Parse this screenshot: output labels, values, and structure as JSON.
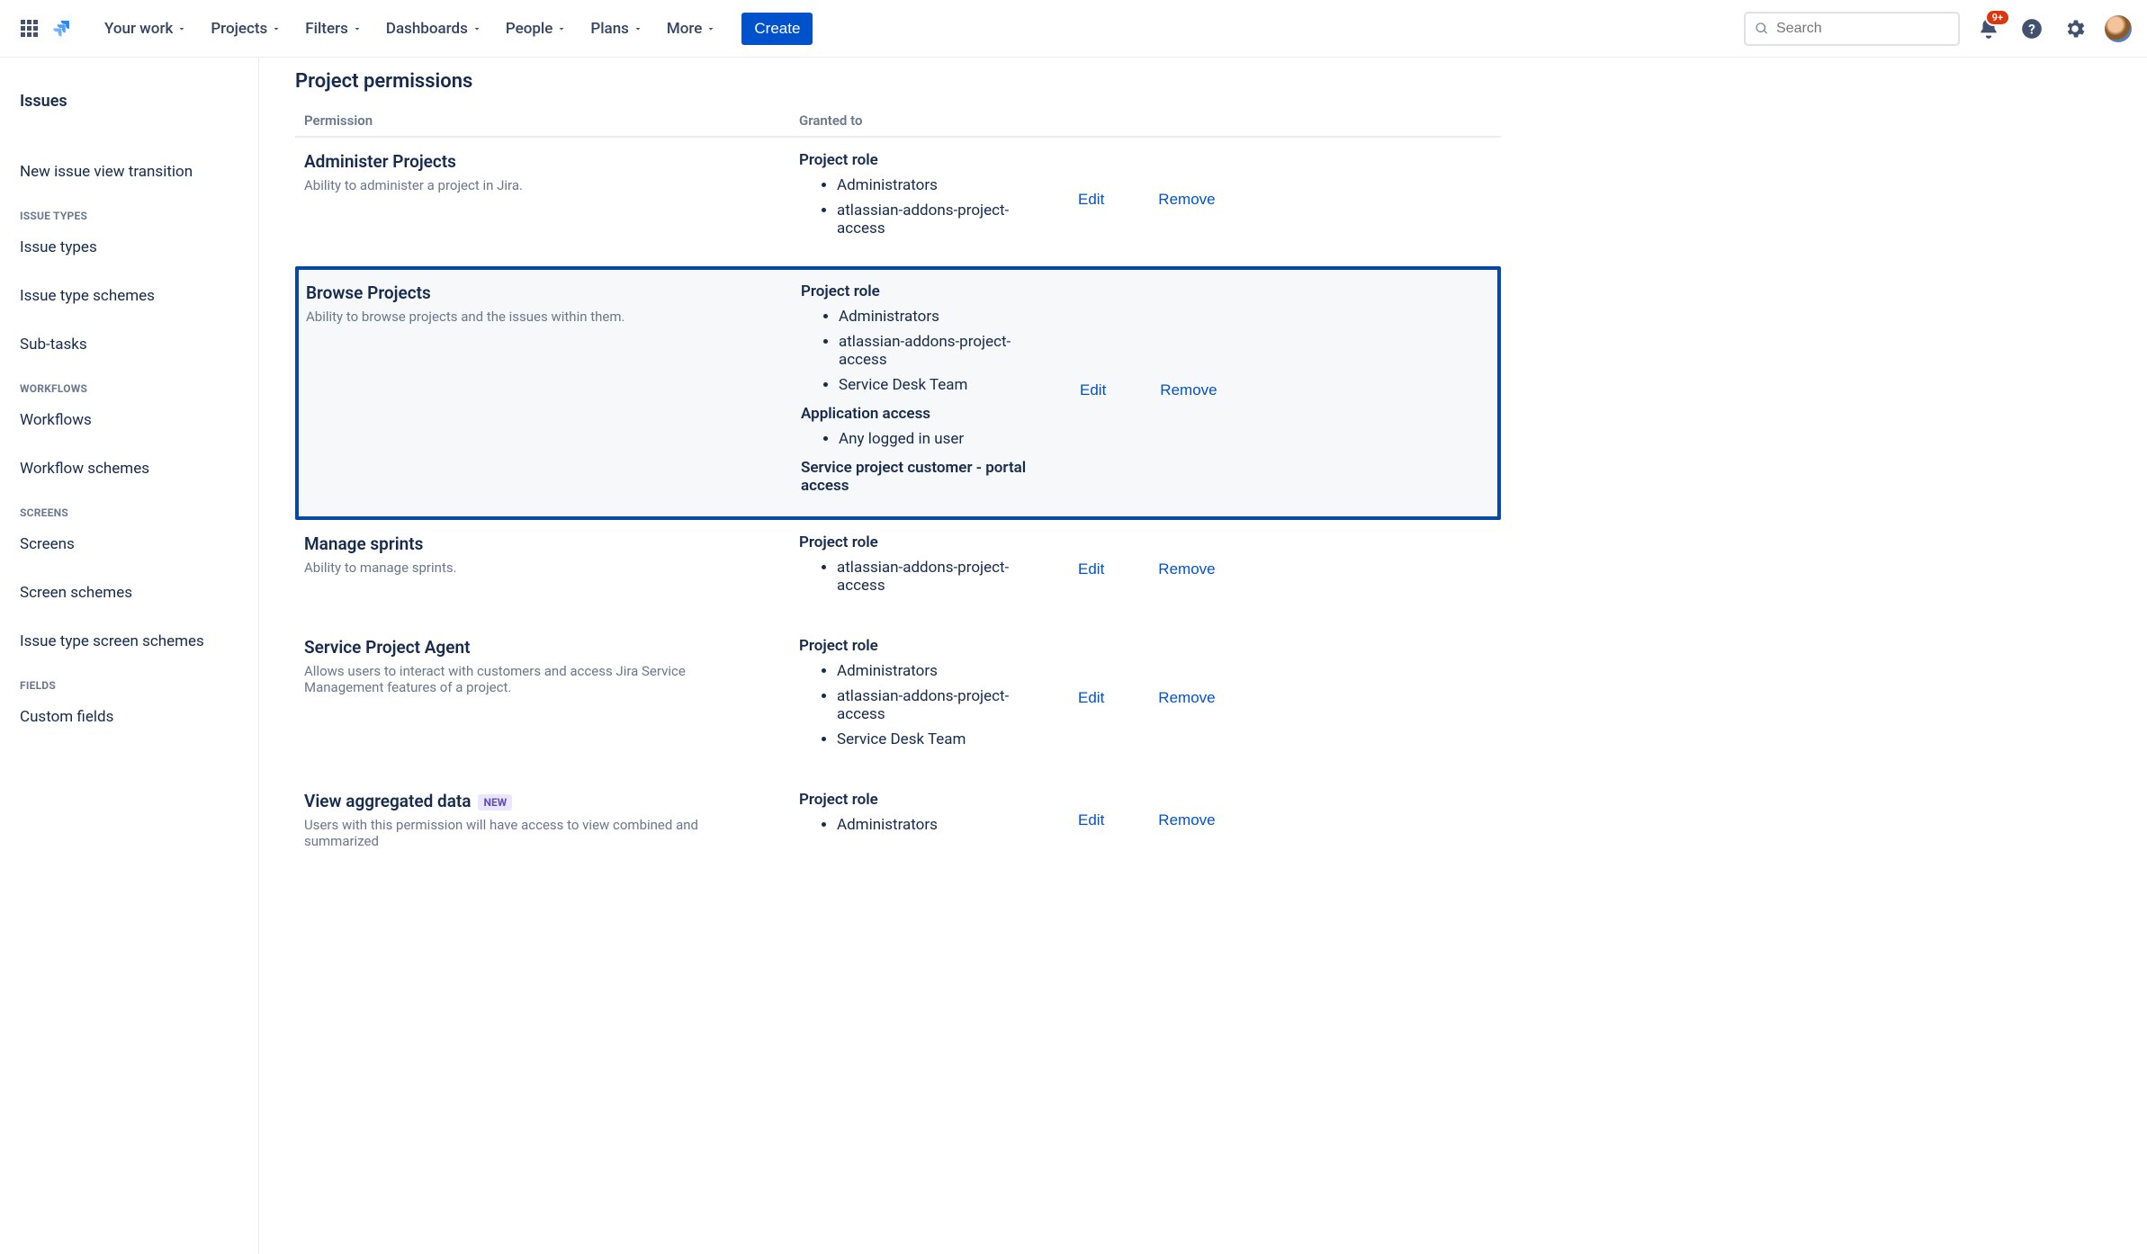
{
  "nav": {
    "items": [
      "Your work",
      "Projects",
      "Filters",
      "Dashboards",
      "People",
      "Plans",
      "More"
    ],
    "create": "Create",
    "search_placeholder": "Search",
    "notification_badge": "9+"
  },
  "sidebar": {
    "top": "Issues",
    "links": [
      "New issue view transition"
    ],
    "sections": [
      {
        "label": "ISSUE TYPES",
        "items": [
          "Issue types",
          "Issue type schemes",
          "Sub-tasks"
        ]
      },
      {
        "label": "WORKFLOWS",
        "items": [
          "Workflows",
          "Workflow schemes"
        ]
      },
      {
        "label": "SCREENS",
        "items": [
          "Screens",
          "Screen schemes",
          "Issue type screen schemes"
        ]
      },
      {
        "label": "FIELDS",
        "items": [
          "Custom fields"
        ]
      }
    ]
  },
  "page": {
    "title": "Project permissions",
    "col_permission": "Permission",
    "col_granted": "Granted to",
    "edit": "Edit",
    "remove": "Remove",
    "new_badge": "NEW"
  },
  "permissions": [
    {
      "name": "Administer Projects",
      "desc": "Ability to administer a project in Jira.",
      "highlight": false,
      "badge": false,
      "grants": [
        {
          "heading": "Project role",
          "items": [
            "Administrators",
            "atlassian-addons-project-access"
          ]
        }
      ]
    },
    {
      "name": "Browse Projects",
      "desc": "Ability to browse projects and the issues within them.",
      "highlight": true,
      "badge": false,
      "grants": [
        {
          "heading": "Project role",
          "items": [
            "Administrators",
            "atlassian-addons-project-access",
            "Service Desk Team"
          ]
        },
        {
          "heading": "Application access",
          "items": [
            "Any logged in user"
          ]
        },
        {
          "heading": "Service project customer - portal access",
          "items": []
        }
      ]
    },
    {
      "name": "Manage sprints",
      "desc": "Ability to manage sprints.",
      "highlight": false,
      "badge": false,
      "grants": [
        {
          "heading": "Project role",
          "items": [
            "atlassian-addons-project-access"
          ]
        }
      ]
    },
    {
      "name": "Service Project Agent",
      "desc": "Allows users to interact with customers and access Jira Service Management features of a project.",
      "highlight": false,
      "badge": false,
      "grants": [
        {
          "heading": "Project role",
          "items": [
            "Administrators",
            "atlassian-addons-project-access",
            "Service Desk Team"
          ]
        }
      ]
    },
    {
      "name": "View aggregated data",
      "desc": "Users with this permission will have access to view combined and summarized",
      "highlight": false,
      "badge": true,
      "grants": [
        {
          "heading": "Project role",
          "items": [
            "Administrators"
          ]
        }
      ]
    }
  ]
}
